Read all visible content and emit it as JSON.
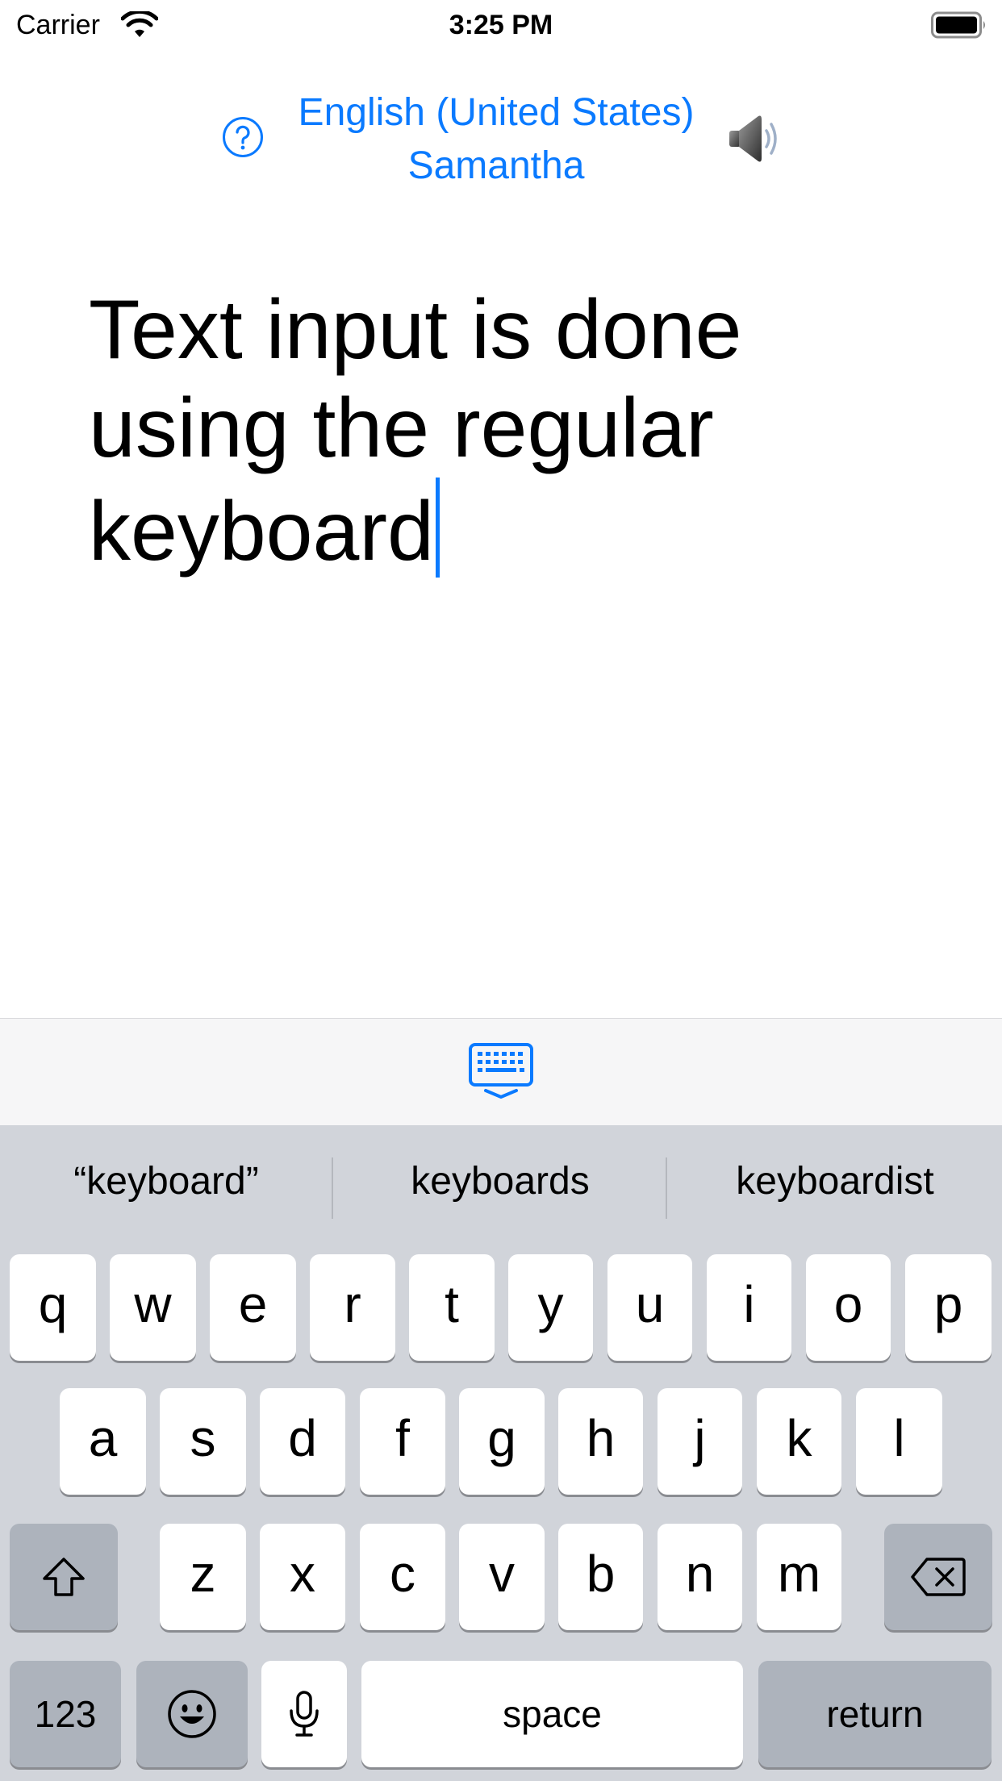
{
  "status_bar": {
    "carrier": "Carrier",
    "time": "3:25 PM"
  },
  "header": {
    "language": "English (United States)",
    "voice": "Samantha",
    "help_icon": "question-circle-icon",
    "speaker_icon": "speaker-icon"
  },
  "text_input": {
    "value": "Text input is done using the regular keyboard"
  },
  "accessory": {
    "icon": "keyboard-hide-icon"
  },
  "keyboard": {
    "suggestions": [
      "“keyboard”",
      "keyboards",
      "keyboardist"
    ],
    "row1": [
      "q",
      "w",
      "e",
      "r",
      "t",
      "y",
      "u",
      "i",
      "o",
      "p"
    ],
    "row2": [
      "a",
      "s",
      "d",
      "f",
      "g",
      "h",
      "j",
      "k",
      "l"
    ],
    "row3": [
      "z",
      "x",
      "c",
      "v",
      "b",
      "n",
      "m"
    ],
    "numbers_label": "123",
    "space_label": "space",
    "return_label": "return",
    "shift_icon": "shift-icon",
    "delete_icon": "delete-icon",
    "emoji_icon": "emoji-icon",
    "mic_icon": "microphone-icon"
  },
  "colors": {
    "accent": "#0a7aff",
    "keyboard_bg": "#d1d4da",
    "key_bg": "#ffffff",
    "dark_key_bg": "#adb3bc"
  }
}
